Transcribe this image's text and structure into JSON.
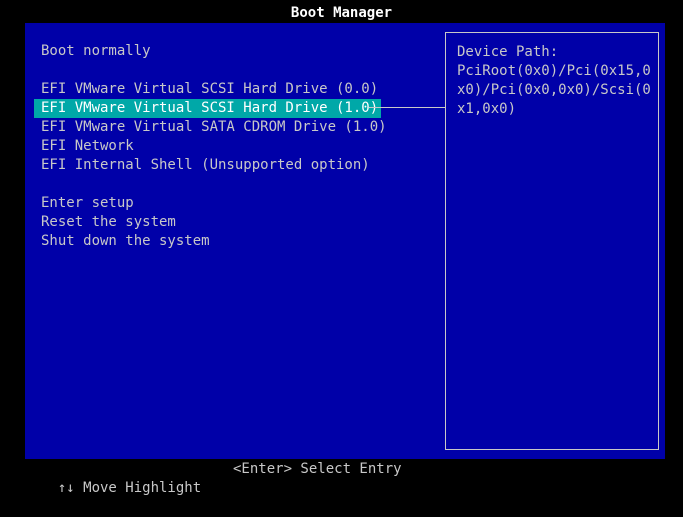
{
  "title": "Boot Manager",
  "menu": {
    "items": [
      {
        "label": "Boot normally",
        "selected": false
      },
      {
        "label": "",
        "gap": true
      },
      {
        "label": "EFI VMware Virtual SCSI Hard Drive (0.0)",
        "selected": false
      },
      {
        "label": "EFI VMware Virtual SCSI Hard Drive (1.0)",
        "selected": true
      },
      {
        "label": "EFI VMware Virtual SATA CDROM Drive (1.0)",
        "selected": false
      },
      {
        "label": "EFI Network",
        "selected": false
      },
      {
        "label": "EFI Internal Shell (Unsupported option)",
        "selected": false
      },
      {
        "label": "",
        "gap": true
      },
      {
        "label": "Enter setup",
        "selected": false
      },
      {
        "label": "Reset the system",
        "selected": false
      },
      {
        "label": "Shut down the system",
        "selected": false
      }
    ]
  },
  "help": {
    "title": "Device Path:",
    "text": "PciRoot(0x0)/Pci(0x15,0x0)/Pci(0x0,0x0)/Scsi(0x1,0x0)"
  },
  "footer": {
    "move": "↑↓ Move Highlight",
    "select": "<Enter> Select Entry"
  },
  "colors": {
    "background": "#000000",
    "panel": "#0000a8",
    "text": "#c8c8c8",
    "highlight": "#00a8a8",
    "title": "#ffffff"
  }
}
